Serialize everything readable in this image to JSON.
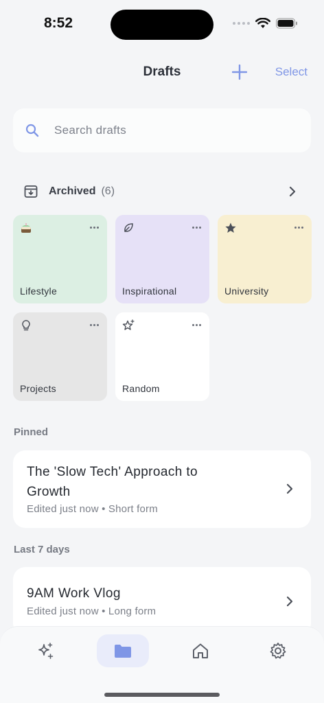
{
  "status": {
    "time": "8:52"
  },
  "header": {
    "title": "Drafts",
    "add_icon": "plus-icon",
    "select_label": "Select"
  },
  "search": {
    "placeholder": "Search drafts",
    "value": ""
  },
  "archived": {
    "label": "Archived",
    "count": "(6)"
  },
  "folders": [
    {
      "name": "Lifestyle",
      "icon": "cake-icon",
      "color": "#dcefe3"
    },
    {
      "name": "Inspirational",
      "icon": "leaf-icon",
      "color": "#e6e1f7"
    },
    {
      "name": "University",
      "icon": "star-icon",
      "color": "#f8efd1"
    },
    {
      "name": "Projects",
      "icon": "lightbulb-icon",
      "color": "#e6e6e6"
    },
    {
      "name": "Random",
      "icon": "sparkle-star-icon",
      "color": "#ffffff"
    }
  ],
  "sections": {
    "pinned": "Pinned",
    "last7": "Last 7 days"
  },
  "pinned_drafts": [
    {
      "title_line1": "The 'Slow Tech' Approach to",
      "title_line2": "Growth",
      "meta": "Edited just now • Short form"
    }
  ],
  "recent_drafts": [
    {
      "title": "9AM Work Vlog",
      "meta": "Edited just now • Long form"
    }
  ],
  "tabs": [
    {
      "name": "ai-sparkle",
      "icon": "sparkles-icon",
      "active": false
    },
    {
      "name": "drafts",
      "icon": "folder-icon",
      "active": true
    },
    {
      "name": "home",
      "icon": "home-icon",
      "active": false
    },
    {
      "name": "settings",
      "icon": "gear-icon",
      "active": false
    }
  ],
  "colors": {
    "accent": "#7f96e6",
    "background": "#f4f5f7"
  }
}
